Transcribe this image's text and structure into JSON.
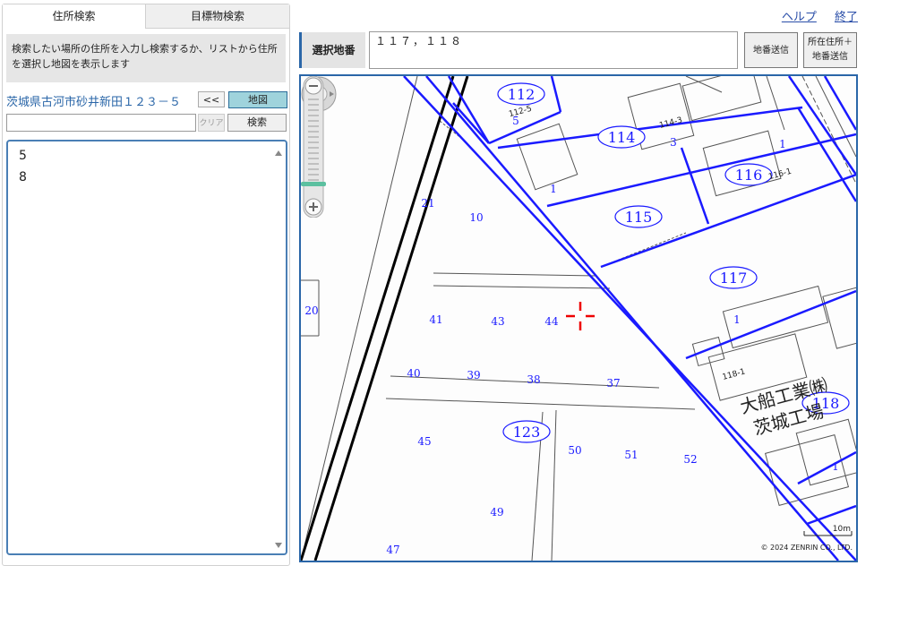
{
  "tabs": {
    "address": "住所検索",
    "landmark": "目標物検索"
  },
  "description": "検索したい場所の住所を入力し検索するか、リストから住所を選択し地図を表示します",
  "address": {
    "text": "茨城県古河市砂井新田１２３－５",
    "back_label": "<<",
    "map_label": "地図"
  },
  "search": {
    "value": "",
    "placeholder": "",
    "clear_label": "クリア",
    "search_label": "検索"
  },
  "results": [
    "5",
    "8"
  ],
  "header": {
    "help": "ヘルプ",
    "exit": "終了",
    "parcel_label": "選択地番",
    "parcel_value": "１１７，１１８",
    "send_label": "地番送信",
    "send_with_address_line1": "所在住所＋",
    "send_with_address_line2": "地番送信"
  },
  "map": {
    "copyright": "© 2024 ZENRIN CO., LTD.",
    "scale": "10m",
    "line_color": "#1a1aff",
    "parcels": [
      "112",
      "114",
      "116",
      "115",
      "117",
      "118",
      "123"
    ],
    "lots": [
      "5",
      "3",
      "1",
      "1",
      "21",
      "10",
      "20",
      "41",
      "43",
      "44",
      "40",
      "39",
      "38",
      "37",
      "45",
      "50",
      "51",
      "52",
      "49",
      "47",
      "1",
      "1"
    ],
    "small_labels": [
      "112-5",
      "114-3",
      "116-1",
      "118-1"
    ],
    "building_name_line1": "大船工業㈱",
    "building_name_line2": "茨城工場"
  }
}
